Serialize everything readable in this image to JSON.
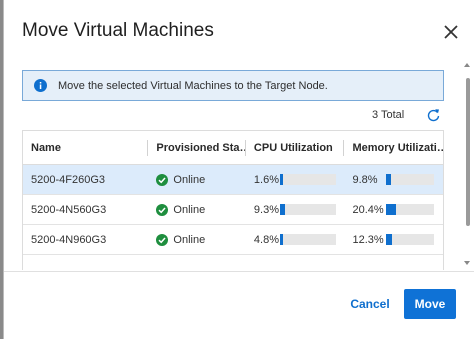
{
  "dialog": {
    "title": "Move Virtual Machines",
    "close_icon": "close-icon"
  },
  "info": {
    "icon": "info-icon",
    "message": "Move the selected Virtual Machines to the Target Node."
  },
  "toolbar": {
    "total": "3 Total",
    "refresh_icon": "refresh-icon"
  },
  "table": {
    "headers": [
      "Name",
      "Provisioned Sta…",
      "CPU Utilization",
      "Memory Utilizati…"
    ],
    "rows": [
      {
        "name": "5200-4F260G3",
        "status": "Online",
        "cpu": "1.6%",
        "cpu_fraction": 0.016,
        "memory": "9.8%",
        "memory_fraction": 0.098,
        "selected": true
      },
      {
        "name": "5200-4N560G3",
        "status": "Online",
        "cpu": "9.3%",
        "cpu_fraction": 0.093,
        "memory": "20.4%",
        "memory_fraction": 0.204,
        "selected": false
      },
      {
        "name": "5200-4N960G3",
        "status": "Online",
        "cpu": "4.8%",
        "cpu_fraction": 0.048,
        "memory": "12.3%",
        "memory_fraction": 0.123,
        "selected": false
      }
    ]
  },
  "footer": {
    "cancel_label": "Cancel",
    "move_label": "Move"
  },
  "colors": {
    "accent": "#0f6fce",
    "info_background": "#e5eff9",
    "online_green": "#1e8e3e",
    "selected_row": "#dcebfb"
  }
}
